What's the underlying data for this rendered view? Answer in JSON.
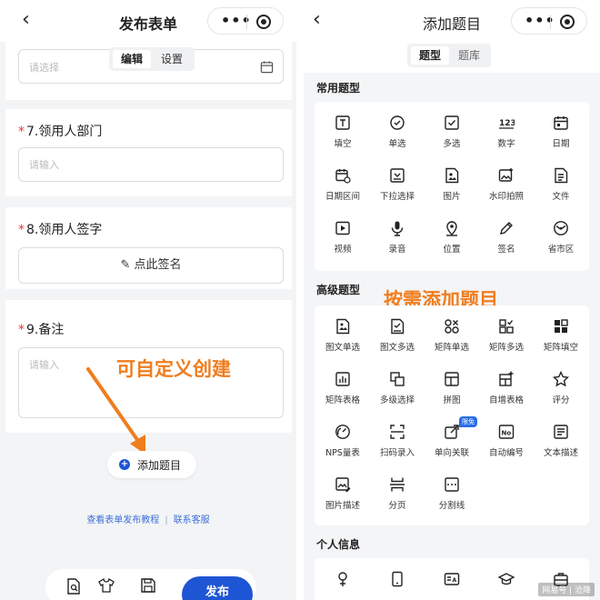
{
  "left": {
    "title": "发布表单",
    "tabs": [
      "编辑",
      "设置"
    ],
    "select_placeholder": "请选择",
    "q7_label": "7.领用人部门",
    "q7_placeholder": "请输入",
    "q8_label": "8.领用人签字",
    "q8_button": "点此签名",
    "q9_label": "9.备注",
    "q9_placeholder": "请输入",
    "add_question": "添加题目",
    "annotation": "可自定义创建",
    "link_tutorial": "查看表单发布教程",
    "link_separator": "|",
    "link_support": "联系客服",
    "publish": "发布"
  },
  "right": {
    "title": "添加题目",
    "tabs": [
      "题型",
      "题库"
    ],
    "section_common": "常用题型",
    "section_advanced": "高级题型",
    "section_personal": "个人信息",
    "annotation": "按需添加题目",
    "common": [
      {
        "label": "填空",
        "icon": "text-icon"
      },
      {
        "label": "单选",
        "icon": "radio-icon"
      },
      {
        "label": "多选",
        "icon": "checkbox-icon"
      },
      {
        "label": "数字",
        "icon": "number-icon"
      },
      {
        "label": "日期",
        "icon": "calendar-icon"
      },
      {
        "label": "日期区间",
        "icon": "date-range-icon"
      },
      {
        "label": "下拉选择",
        "icon": "dropdown-icon"
      },
      {
        "label": "图片",
        "icon": "image-icon"
      },
      {
        "label": "水印拍照",
        "icon": "watermark-photo-icon"
      },
      {
        "label": "文件",
        "icon": "file-icon"
      },
      {
        "label": "视频",
        "icon": "video-icon"
      },
      {
        "label": "录音",
        "icon": "microphone-icon"
      },
      {
        "label": "位置",
        "icon": "location-icon"
      },
      {
        "label": "签名",
        "icon": "pen-icon"
      },
      {
        "label": "省市区",
        "icon": "region-icon"
      }
    ],
    "advanced": [
      {
        "label": "图文单选",
        "icon": "image-radio-icon"
      },
      {
        "label": "图文多选",
        "icon": "image-checkbox-icon"
      },
      {
        "label": "矩阵单选",
        "icon": "matrix-radio-icon"
      },
      {
        "label": "矩阵多选",
        "icon": "matrix-checkbox-icon"
      },
      {
        "label": "矩阵填空",
        "icon": "matrix-fill-icon"
      },
      {
        "label": "矩阵表格",
        "icon": "matrix-table-icon"
      },
      {
        "label": "多级选择",
        "icon": "cascade-icon"
      },
      {
        "label": "拼图",
        "icon": "puzzle-icon"
      },
      {
        "label": "自增表格",
        "icon": "add-table-icon"
      },
      {
        "label": "评分",
        "icon": "star-icon"
      },
      {
        "label": "NPS量表",
        "icon": "gauge-icon"
      },
      {
        "label": "扫码录入",
        "icon": "scan-icon"
      },
      {
        "label": "单向关联",
        "icon": "link-out-icon",
        "badge": "限免"
      },
      {
        "label": "自动编号",
        "icon": "auto-number-icon"
      },
      {
        "label": "文本描述",
        "icon": "text-description-icon"
      },
      {
        "label": "图片描述",
        "icon": "image-description-icon"
      },
      {
        "label": "分页",
        "icon": "page-break-icon"
      },
      {
        "label": "分割线",
        "icon": "divider-icon"
      }
    ],
    "personal_icons": [
      "person-icon",
      "phone-icon",
      "id-card-icon",
      "education-icon",
      "briefcase-icon"
    ]
  },
  "watermark": "网易号 | 沧降",
  "colors": {
    "accent": "#1e55d4",
    "annotation": "#f07d1e",
    "required": "#e53935"
  }
}
